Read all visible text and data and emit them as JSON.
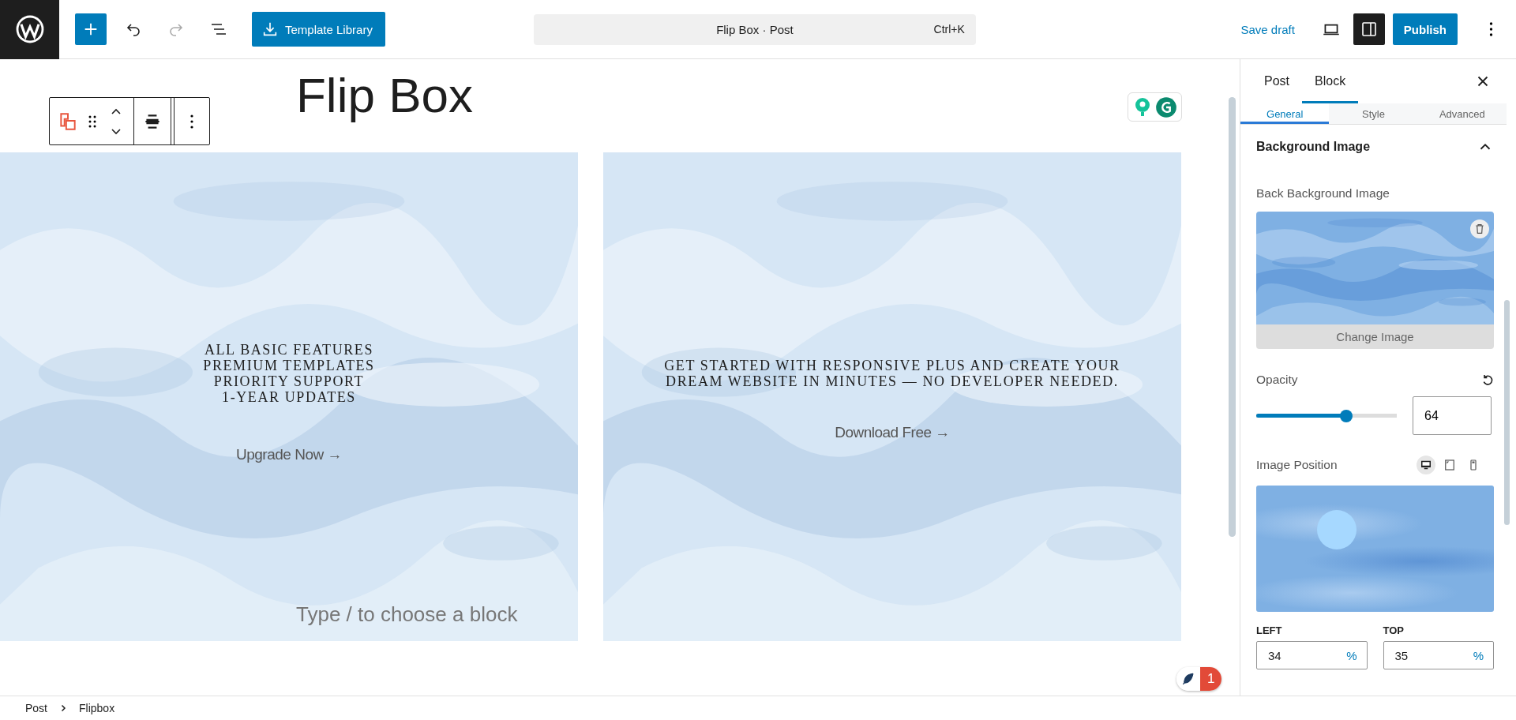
{
  "toolbar": {
    "template_button": "Template Library",
    "command": {
      "title": "Flip Box · Post",
      "shortcut": "Ctrl+K"
    },
    "save_draft": "Save draft",
    "publish": "Publish",
    "sidebar_open": true
  },
  "editor": {
    "title": "Flip Box",
    "placeholder": "Type / to choose a block",
    "cards": [
      {
        "lines": [
          "ALL BASIC FEATURES",
          "PREMIUM TEMPLATES",
          "PRIORITY SUPPORT",
          "1-YEAR UPDATES"
        ],
        "link": "Upgrade Now →"
      },
      {
        "lines": [
          "GET STARTED WITH RESPONSIVE PLUS AND CREATE YOUR",
          "DREAM WEBSITE IN MINUTES — NO DEVELOPER NEEDED."
        ],
        "link": "Download Free →"
      }
    ],
    "notifications": "1"
  },
  "sidebar": {
    "tabs": [
      {
        "label": "Post",
        "selected": false
      },
      {
        "label": "Block",
        "selected": true
      }
    ],
    "subtabs": [
      {
        "label": "General",
        "selected": true
      },
      {
        "label": "Style",
        "selected": false
      },
      {
        "label": "Advanced",
        "selected": false
      }
    ],
    "section": {
      "title": "Background Image",
      "expanded": true
    },
    "image_label": "Back Background Image",
    "change_image": "Change Image",
    "opacity": {
      "label": "Opacity",
      "level": 0.64,
      "value": "64"
    },
    "position": {
      "label": "Image Position",
      "devices": [
        {
          "kind": "desktop",
          "selected": true
        },
        {
          "kind": "tablet",
          "selected": false
        },
        {
          "kind": "mobile",
          "selected": false
        }
      ],
      "fields": [
        {
          "label": "LEFT",
          "value": "34",
          "unit": "%"
        },
        {
          "label": "TOP",
          "value": "35",
          "unit": "%"
        }
      ]
    }
  },
  "breadcrumb": [
    "Post",
    "Flipbox"
  ]
}
